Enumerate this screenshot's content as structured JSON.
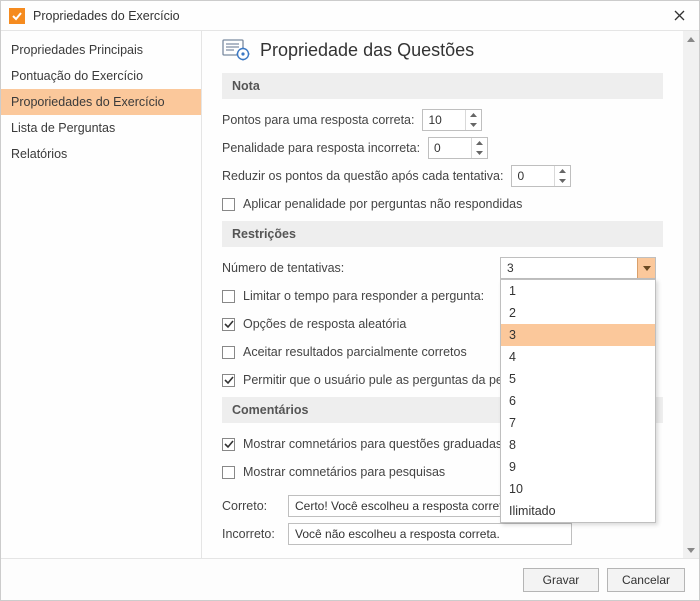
{
  "window": {
    "title": "Propriedades do Exercício"
  },
  "sidebar": {
    "items": [
      {
        "label": "Propriedades Principais"
      },
      {
        "label": "Pontuação do Exercício"
      },
      {
        "label": "Proporiedades do Exercício"
      },
      {
        "label": "Lista de Perguntas"
      },
      {
        "label": "Relatórios"
      }
    ],
    "selected_index": 2
  },
  "page": {
    "title": "Propriedade das Questões",
    "sections": {
      "score": {
        "heading": "Nota",
        "points_correct_label": "Pontos para uma resposta correta:",
        "points_correct_value": "10",
        "penalty_incorrect_label": "Penalidade para resposta incorreta:",
        "penalty_incorrect_value": "0",
        "reduce_points_label": "Reduzir os pontos da questão após cada tentativa:",
        "reduce_points_value": "0",
        "apply_penalty_unanswered_label": "Aplicar penalidade por perguntas não respondidas",
        "apply_penalty_unanswered_checked": false
      },
      "restrictions": {
        "heading": "Restrições",
        "attempts_label": "Número de tentativas:",
        "attempts_value": "3",
        "attempts_options": [
          "1",
          "2",
          "3",
          "4",
          "5",
          "6",
          "7",
          "8",
          "9",
          "10",
          "Ilimitado"
        ],
        "limit_time_label": "Limitar o tempo para responder a pergunta:",
        "limit_time_checked": false,
        "random_answers_label": "Opções de resposta aleatória",
        "random_answers_checked": true,
        "accept_partial_label": "Aceitar resultados parcialmente corretos",
        "accept_partial_checked": false,
        "allow_skip_label": "Permitir que o usuário pule as perguntas da pesquisa",
        "allow_skip_checked": true
      },
      "feedback": {
        "heading": "Comentários",
        "show_graded_label": "Mostrar comnetários para questões graduadas",
        "show_graded_checked": true,
        "show_survey_label": "Mostrar comnetários para pesquisas",
        "show_survey_checked": false,
        "correct_label": "Correto:",
        "correct_value": "Certo! Você escolheu a resposta correta.",
        "incorrect_label": "Incorreto:",
        "incorrect_value": "Você não escolheu a resposta correta."
      }
    }
  },
  "footer": {
    "save": "Gravar",
    "cancel": "Cancelar"
  }
}
